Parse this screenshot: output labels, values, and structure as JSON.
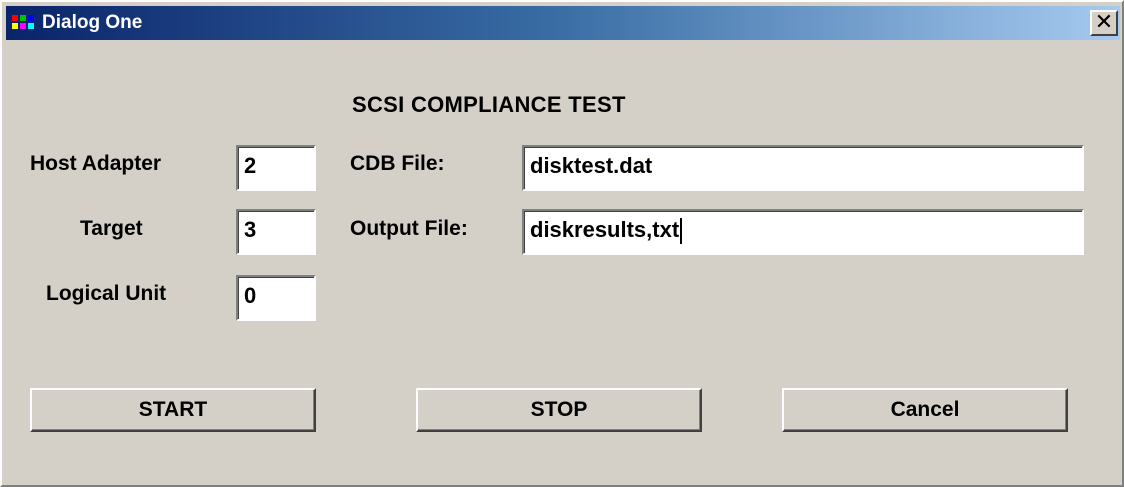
{
  "window": {
    "title": "Dialog One",
    "close_label": "✕"
  },
  "heading": "SCSI COMPLIANCE TEST",
  "fields": {
    "host_adapter": {
      "label": "Host Adapter",
      "value": "2"
    },
    "target": {
      "label": "Target",
      "value": "3"
    },
    "logical_unit": {
      "label": "Logical Unit",
      "value": "0"
    },
    "cdb_file": {
      "label": "CDB File:",
      "value": "disktest.dat"
    },
    "output_file": {
      "label": "Output File:",
      "value": "diskresults,txt"
    }
  },
  "buttons": {
    "start": "START",
    "stop": "STOP",
    "cancel": "Cancel"
  },
  "colors": {
    "face": "#d4d0c8",
    "titlebar_start": "#0a246a",
    "titlebar_end": "#a6caf0"
  }
}
